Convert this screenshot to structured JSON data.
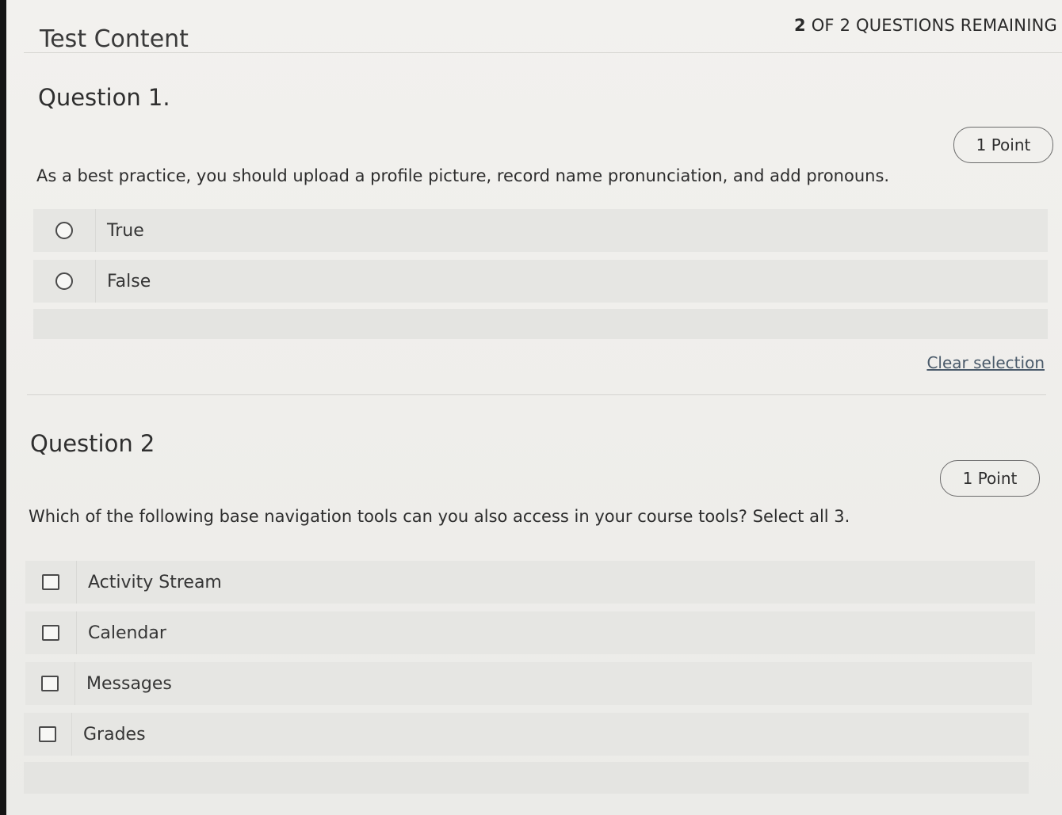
{
  "header": {
    "remaining_num": "2",
    "remaining_text": "OF 2 QUESTIONS REMAINING",
    "title": "Test Content"
  },
  "questions": [
    {
      "heading": "Question 1.",
      "points": "1 Point",
      "text": "As a best practice, you should upload a profile picture, record name pronunciation, and add pronouns.",
      "type": "radio",
      "options": [
        "True",
        "False"
      ],
      "clear_label": "Clear selection"
    },
    {
      "heading": "Question 2",
      "points": "1 Point",
      "text": "Which of the following base navigation tools can you also access in your course tools? Select all 3.",
      "type": "checkbox",
      "options": [
        "Activity Stream",
        "Calendar",
        "Messages",
        "Grades"
      ]
    }
  ],
  "colors": {
    "background": "#efeeeb",
    "option_bg": "#e6e6e3",
    "text": "#2f2f2f",
    "link": "#4a5a6a"
  }
}
